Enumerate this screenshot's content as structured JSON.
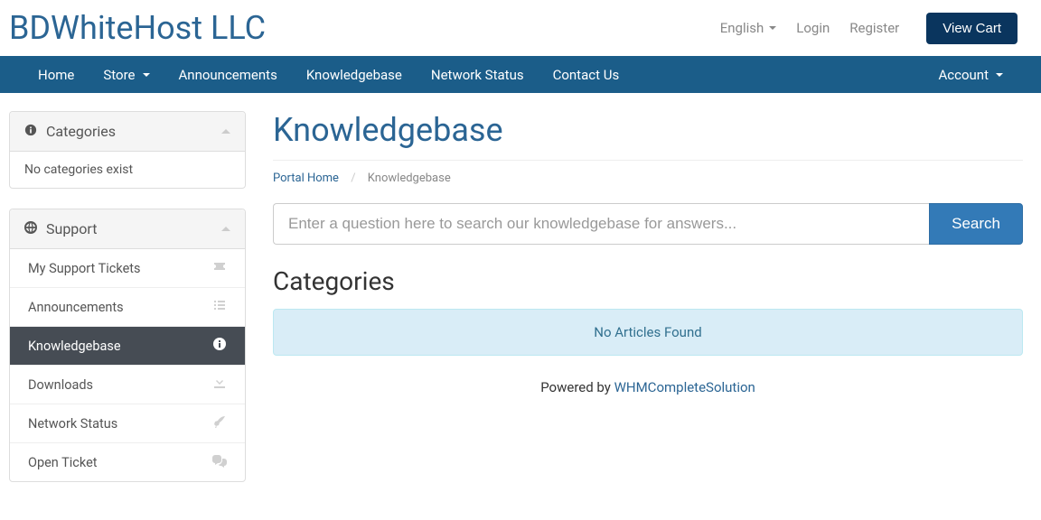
{
  "brand": "BDWhiteHost LLC",
  "topnav": {
    "language": "English",
    "login": "Login",
    "register": "Register",
    "view_cart": "View Cart"
  },
  "nav": {
    "home": "Home",
    "store": "Store",
    "announcements": "Announcements",
    "knowledgebase": "Knowledgebase",
    "network_status": "Network Status",
    "contact_us": "Contact Us",
    "account": "Account"
  },
  "sidebar": {
    "categories_title": "Categories",
    "no_categories": "No categories exist",
    "support_title": "Support",
    "items": {
      "tickets": "My Support Tickets",
      "announcements": "Announcements",
      "knowledgebase": "Knowledgebase",
      "downloads": "Downloads",
      "network_status": "Network Status",
      "open_ticket": "Open Ticket"
    }
  },
  "page": {
    "title": "Knowledgebase",
    "breadcrumb_home": "Portal Home",
    "breadcrumb_current": "Knowledgebase"
  },
  "search": {
    "placeholder": "Enter a question here to search our knowledgebase for answers...",
    "button": "Search"
  },
  "content": {
    "section_title": "Categories",
    "no_articles": "No Articles Found"
  },
  "footer": {
    "powered_by": "Powered by ",
    "link": "WHMCompleteSolution"
  }
}
